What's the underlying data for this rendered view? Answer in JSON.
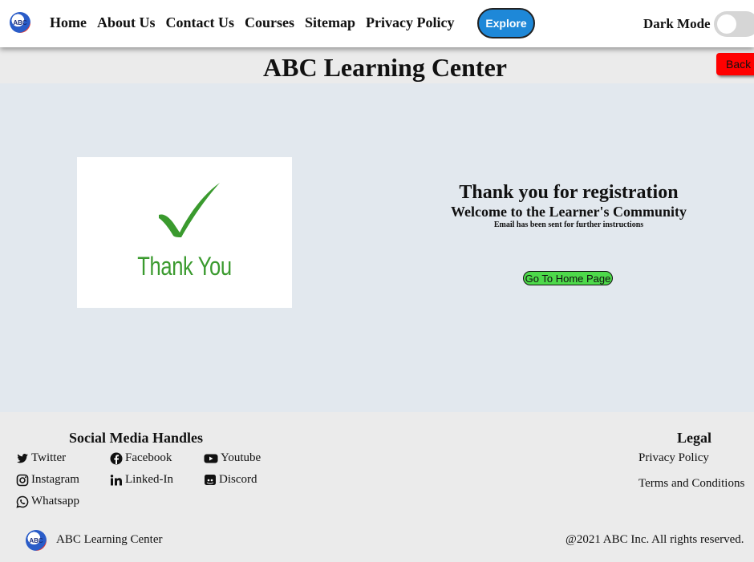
{
  "nav": {
    "logo_text": "ABC",
    "links": [
      "Home",
      "About Us",
      "Contact Us",
      "Courses",
      "Sitemap",
      "Privacy Policy"
    ],
    "explore_label": "Explore",
    "dark_mode_label": "Dark Mode"
  },
  "header": {
    "title": "ABC Learning Center",
    "back_label": "Back"
  },
  "main": {
    "card_text": "Thank You",
    "heading": "Thank you for registration",
    "subheading": "Welcome to the Learner's Community",
    "note": "Email has been sent for further instructions",
    "home_button": "Go To Home Page"
  },
  "footer": {
    "social_title": "Social Media Handles",
    "social": [
      "Twitter",
      "Facebook",
      "Youtube",
      "Instagram",
      "Linked-In",
      "Discord",
      "Whatsapp"
    ],
    "legal_title": "Legal",
    "legal_links": [
      "Privacy Policy",
      "Terms and Conditions"
    ],
    "brand": "ABC Learning Center",
    "copyright": "@2021 ABC Inc. All rights reserved."
  },
  "colors": {
    "explore_bg": "#1e88d8",
    "back_bg": "#ff0000",
    "home_btn_bg": "#4dd94a",
    "thank_green": "#3a9a2e"
  }
}
